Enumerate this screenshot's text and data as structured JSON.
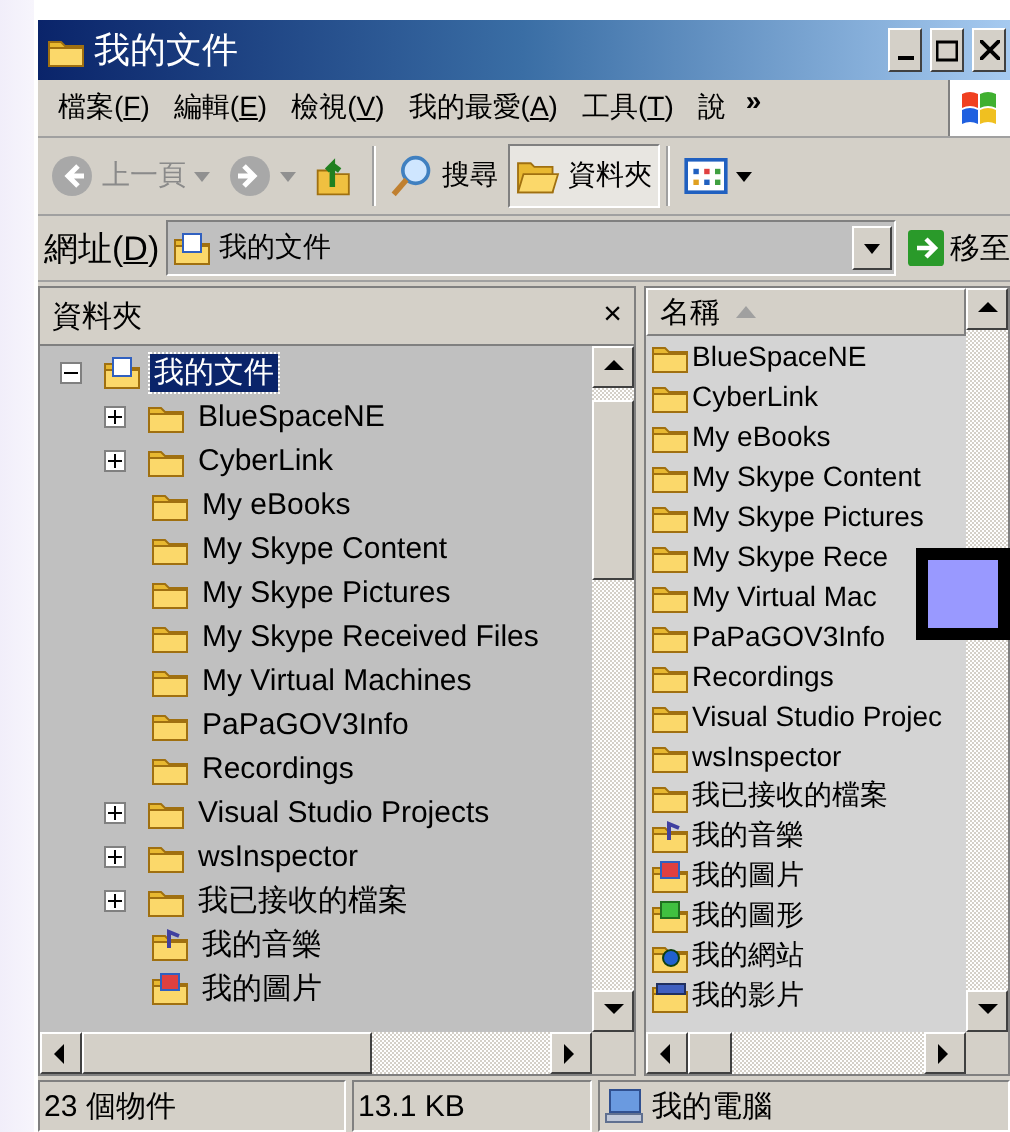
{
  "window": {
    "title": "我的文件"
  },
  "menu": [
    {
      "before": "檔案(",
      "key": "F",
      "after": ")"
    },
    {
      "before": "編輯(",
      "key": "E",
      "after": ")"
    },
    {
      "before": "檢視(",
      "key": "V",
      "after": ")"
    },
    {
      "before": "我的最愛(",
      "key": "A",
      "after": ")"
    },
    {
      "before": "工具(",
      "key": "T",
      "after": ")"
    },
    {
      "text": "說"
    }
  ],
  "menu_overflow": "»",
  "toolbar": [
    {
      "kind": "back",
      "label": "上一頁",
      "disabled": true
    },
    {
      "kind": "forward",
      "disabled": true
    },
    {
      "kind": "up"
    },
    {
      "kind": "search",
      "label": "搜尋",
      "pressed": false
    },
    {
      "kind": "folders",
      "label": "資料夾",
      "pressed": true
    },
    {
      "kind": "views"
    }
  ],
  "address": {
    "before": "網址(",
    "key": "D",
    "after": ")",
    "value": "我的文件",
    "go_label": "移至"
  },
  "folders_pane": {
    "title": "資料夾",
    "close": "×",
    "tree": {
      "label": "我的文件",
      "kind": "documents",
      "selected": true,
      "expanded": true,
      "children": [
        {
          "label": "BlueSpaceNE",
          "kind": "folder",
          "expandable": true,
          "selected": false
        },
        {
          "label": "CyberLink",
          "kind": "folder",
          "expandable": true,
          "selected": false
        },
        {
          "label": "My eBooks",
          "kind": "folder",
          "expandable": false,
          "selected": false
        },
        {
          "label": "My Skype Content",
          "kind": "folder",
          "expandable": false,
          "selected": false
        },
        {
          "label": "My Skype Pictures",
          "kind": "folder",
          "expandable": false,
          "selected": false
        },
        {
          "label": "My Skype Received Files",
          "kind": "folder",
          "expandable": false,
          "selected": false
        },
        {
          "label": "My Virtual Machines",
          "kind": "folder",
          "expandable": false,
          "selected": false
        },
        {
          "label": "PaPaGOV3Info",
          "kind": "folder",
          "expandable": false,
          "selected": false
        },
        {
          "label": "Recordings",
          "kind": "folder",
          "expandable": false,
          "selected": false
        },
        {
          "label": "Visual Studio Projects",
          "kind": "folder",
          "expandable": true,
          "selected": false
        },
        {
          "label": "wsInspector",
          "kind": "folder",
          "expandable": true,
          "selected": false
        },
        {
          "label": "我已接收的檔案",
          "kind": "folder",
          "expandable": true,
          "selected": false
        },
        {
          "label": "我的音樂",
          "kind": "music",
          "expandable": false,
          "selected": false
        },
        {
          "label": "我的圖片",
          "kind": "pictures",
          "expandable": false,
          "selected": false
        }
      ]
    }
  },
  "contents": {
    "column": "名稱",
    "items": [
      {
        "label": "BlueSpaceNE",
        "kind": "folder"
      },
      {
        "label": "CyberLink",
        "kind": "folder"
      },
      {
        "label": "My eBooks",
        "kind": "folder"
      },
      {
        "label": "My Skype Content",
        "kind": "folder"
      },
      {
        "label": "My Skype Pictures",
        "kind": "folder"
      },
      {
        "label": "My Skype Rece",
        "kind": "folder"
      },
      {
        "label": "My Virtual Mac",
        "kind": "folder"
      },
      {
        "label": "PaPaGOV3Info",
        "kind": "folder"
      },
      {
        "label": "Recordings",
        "kind": "folder"
      },
      {
        "label": "Visual Studio Projec",
        "kind": "folder"
      },
      {
        "label": "wsInspector",
        "kind": "folder"
      },
      {
        "label": "我已接收的檔案",
        "kind": "folder"
      },
      {
        "label": "我的音樂",
        "kind": "music"
      },
      {
        "label": "我的圖片",
        "kind": "pictures"
      },
      {
        "label": "我的圖形",
        "kind": "graphics"
      },
      {
        "label": "我的網站",
        "kind": "web"
      },
      {
        "label": "我的影片",
        "kind": "video"
      }
    ]
  },
  "status_bar": {
    "count": "23 個物件",
    "size": "13.1 KB",
    "zone": "我的電腦"
  }
}
